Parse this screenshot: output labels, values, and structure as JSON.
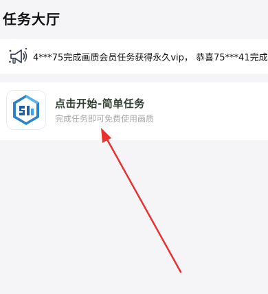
{
  "header": {
    "title": "任务大厅"
  },
  "notice": {
    "icon": "megaphone-icon",
    "text": "4***75完成画质会员任务获得永久vip， 恭喜75***41完成画"
  },
  "task": {
    "logo_icon": "app-logo-icon",
    "title": "点击开始-简单任务",
    "subtitle": "完成任务即可免费使用画质"
  },
  "annotation": {
    "arrow_color": "#e8302e"
  },
  "colors": {
    "page_bg": "#f5f5f7",
    "card_bg": "#ffffff",
    "title_text": "#2f3d2f",
    "subtitle_text": "#a6a6a6"
  }
}
